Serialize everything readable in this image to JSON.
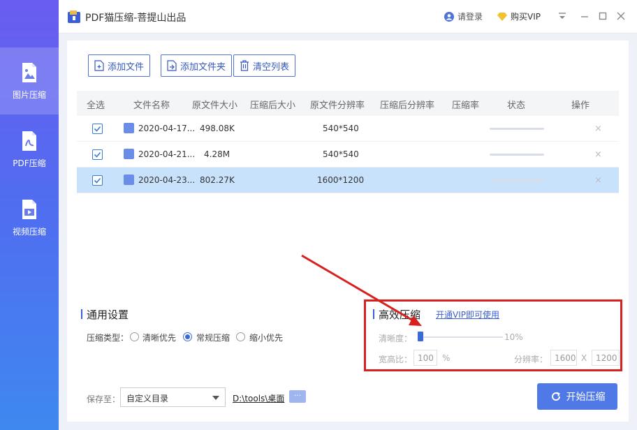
{
  "app": {
    "title": "PDF猫压缩-菩提山出品",
    "login_label": "请登录",
    "vip_label": "购买VIP"
  },
  "sidebar": {
    "items": [
      {
        "label": "图片压缩",
        "icon": "image-file-icon",
        "active": true
      },
      {
        "label": "PDF压缩",
        "icon": "pdf-file-icon",
        "active": false
      },
      {
        "label": "视频压缩",
        "icon": "video-file-icon",
        "active": false
      }
    ]
  },
  "toolbar": {
    "add_file": "添加文件",
    "add_folder": "添加文件夹",
    "clear_list": "清空列表"
  },
  "table": {
    "headers": [
      "全选",
      "文件名称",
      "原文件大小",
      "压缩后大小",
      "原文件分辨率",
      "压缩后分辨率",
      "压缩率",
      "状态",
      "操作"
    ],
    "rows": [
      {
        "checked": true,
        "name": "2020-04-17...",
        "orig_size": "498.08K",
        "compressed_size": "",
        "orig_res": "540*540",
        "compressed_res": "",
        "ratio": "",
        "progress": 0,
        "selected": false
      },
      {
        "checked": true,
        "name": "2020-04-21...",
        "orig_size": "4.28M",
        "compressed_size": "",
        "orig_res": "540*540",
        "compressed_res": "",
        "ratio": "",
        "progress": 0,
        "selected": false
      },
      {
        "checked": true,
        "name": "2020-04-23...",
        "orig_size": "802.27K",
        "compressed_size": "",
        "orig_res": "1600*1200",
        "compressed_res": "",
        "ratio": "",
        "progress": 0,
        "selected": true
      }
    ],
    "delete_glyph": "×"
  },
  "general_settings": {
    "title": "通用设置",
    "type_label": "压缩类型：",
    "options": [
      {
        "label": "清晰优先",
        "checked": false
      },
      {
        "label": "常规压缩",
        "checked": true
      },
      {
        "label": "缩小优先",
        "checked": false
      }
    ]
  },
  "advanced": {
    "title": "高效压缩",
    "vip_link": "开通VIP即可使用",
    "clarity_label": "清晰度：",
    "clarity_value": "10%",
    "clarity_level": 0.1,
    "aspect_label": "宽高比：",
    "aspect_value": "100",
    "aspect_unit": "%",
    "resolution_label": "分辨率：",
    "res_width": "1600",
    "res_sep": "X",
    "res_height": "1200"
  },
  "bottom": {
    "save_label": "保存至：",
    "save_option": "自定义目录",
    "path": "D:\\tools\\桌面",
    "more": "···",
    "start_button": "开始压缩"
  },
  "colors": {
    "accent": "#4f79e6",
    "highlight_box": "#d8201f",
    "selected_row": "#c9e2fb"
  }
}
